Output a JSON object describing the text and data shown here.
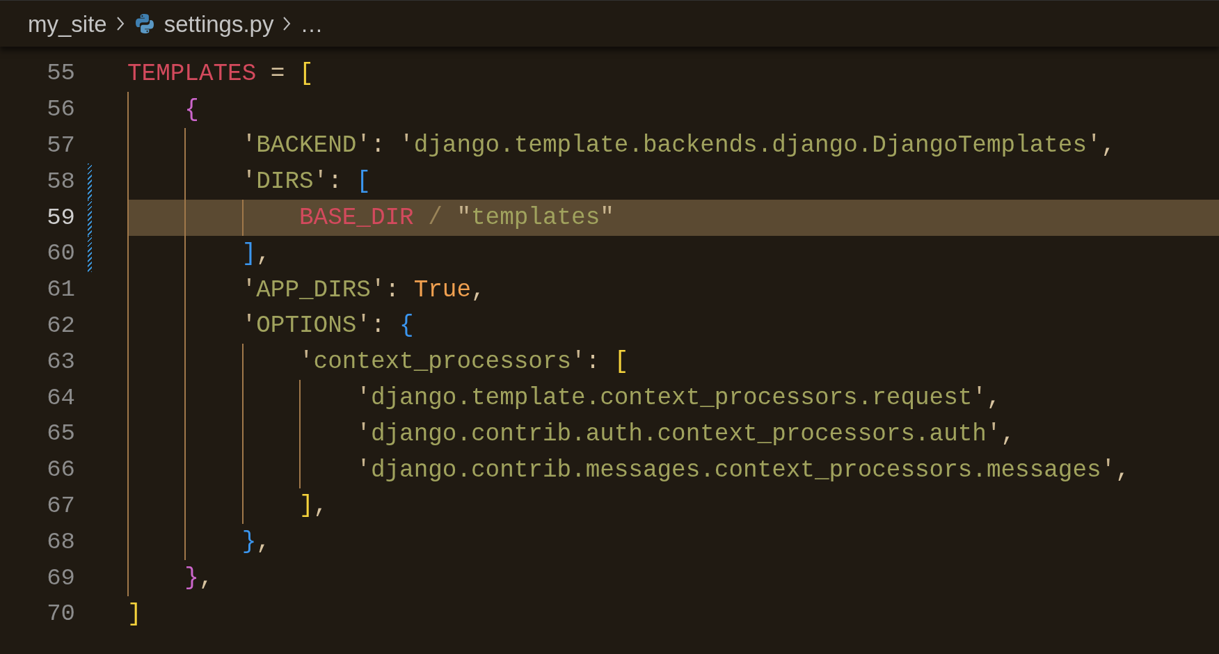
{
  "breadcrumb": [
    {
      "kind": "folder",
      "label": "my_site"
    },
    {
      "kind": "python-file",
      "label": "settings.py"
    },
    {
      "kind": "more",
      "label": "…"
    }
  ],
  "lines": [
    {
      "number": "55",
      "selected": false,
      "modified": false,
      "tokens": [
        {
          "kind": "variable",
          "text": "TEMPLATES"
        },
        {
          "kind": "operator",
          "text": " = "
        },
        {
          "kind": "bracket",
          "color": "#f5d33c",
          "text": "["
        }
      ]
    },
    {
      "number": "56",
      "selected": false,
      "modified": false,
      "tokens": [
        {
          "kind": "bracket",
          "color": "#cc66cc",
          "text": "    {"
        }
      ]
    },
    {
      "number": "57",
      "selected": false,
      "modified": false,
      "tokens": [
        {
          "kind": "string",
          "text": "        'BACKEND'"
        },
        {
          "kind": "operator",
          "text": ": "
        },
        {
          "kind": "string",
          "text": "'django.template.backends.django.DjangoTemplates'"
        },
        {
          "kind": "operator",
          "text": ","
        }
      ]
    },
    {
      "number": "58",
      "selected": false,
      "modified": true,
      "tokens": [
        {
          "kind": "string",
          "text": "        'DIRS'"
        },
        {
          "kind": "operator",
          "text": ": "
        },
        {
          "kind": "bracket",
          "color": "#3b96ef",
          "text": "["
        }
      ]
    },
    {
      "number": "59",
      "selected": true,
      "modified": true,
      "tokens": [
        {
          "kind": "variable",
          "text": "            BASE_DIR"
        },
        {
          "kind": "dim-operator",
          "text": " / "
        },
        {
          "kind": "string",
          "text": "\"templates\""
        }
      ]
    },
    {
      "number": "60",
      "selected": false,
      "modified": true,
      "tokens": [
        {
          "kind": "bracket",
          "color": "#3b96ef",
          "text": "        ]"
        },
        {
          "kind": "operator",
          "text": ","
        }
      ]
    },
    {
      "number": "61",
      "selected": false,
      "modified": false,
      "tokens": [
        {
          "kind": "string",
          "text": "        'APP_DIRS'"
        },
        {
          "kind": "operator",
          "text": ": "
        },
        {
          "kind": "constant",
          "text": "True"
        },
        {
          "kind": "operator",
          "text": ","
        }
      ]
    },
    {
      "number": "62",
      "selected": false,
      "modified": false,
      "tokens": [
        {
          "kind": "string",
          "text": "        'OPTIONS'"
        },
        {
          "kind": "operator",
          "text": ": "
        },
        {
          "kind": "bracket",
          "color": "#3b96ef",
          "text": "{"
        }
      ]
    },
    {
      "number": "63",
      "selected": false,
      "modified": false,
      "tokens": [
        {
          "kind": "string",
          "text": "            'context_processors'"
        },
        {
          "kind": "operator",
          "text": ": "
        },
        {
          "kind": "bracket",
          "color": "#f5d33c",
          "text": "["
        }
      ]
    },
    {
      "number": "64",
      "selected": false,
      "modified": false,
      "tokens": [
        {
          "kind": "string",
          "text": "                'django.template.context_processors.request'"
        },
        {
          "kind": "operator",
          "text": ","
        }
      ]
    },
    {
      "number": "65",
      "selected": false,
      "modified": false,
      "tokens": [
        {
          "kind": "string",
          "text": "                'django.contrib.auth.context_processors.auth'"
        },
        {
          "kind": "operator",
          "text": ","
        }
      ]
    },
    {
      "number": "66",
      "selected": false,
      "modified": false,
      "tokens": [
        {
          "kind": "string",
          "text": "                'django.contrib.messages.context_processors.messages'"
        },
        {
          "kind": "operator",
          "text": ","
        }
      ]
    },
    {
      "number": "67",
      "selected": false,
      "modified": false,
      "tokens": [
        {
          "kind": "bracket",
          "color": "#f5d33c",
          "text": "            ]"
        },
        {
          "kind": "operator",
          "text": ","
        }
      ]
    },
    {
      "number": "68",
      "selected": false,
      "modified": false,
      "tokens": [
        {
          "kind": "bracket",
          "color": "#3b96ef",
          "text": "        }"
        },
        {
          "kind": "operator",
          "text": ","
        }
      ]
    },
    {
      "number": "69",
      "selected": false,
      "modified": false,
      "tokens": [
        {
          "kind": "bracket",
          "color": "#cc66cc",
          "text": "    }"
        },
        {
          "kind": "operator",
          "text": ","
        }
      ]
    },
    {
      "number": "70",
      "selected": false,
      "modified": false,
      "tokens": [
        {
          "kind": "bracket",
          "color": "#f5d33c",
          "text": "]"
        }
      ]
    }
  ]
}
